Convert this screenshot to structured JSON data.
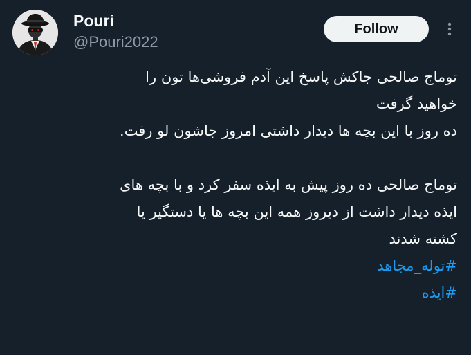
{
  "author": {
    "display_name": "Pouri",
    "handle": "@Pouri2022",
    "avatar_icon": "masked-man-avatar"
  },
  "actions": {
    "follow_label": "Follow",
    "more_icon": "more-vertical-icon"
  },
  "tweet": {
    "lines": [
      "توماج صالحی جاکش پاسخ این آدم فروشی‌ها تون را",
      "خواهید گرفت",
      "ده روز با این بچه ها دیدار داشتی امروز جاشون لو رفت.",
      "",
      "توماج صالحی ده روز پیش به ایذه سفر کرد و با بچه های",
      "ایذه دیدار داشت از دیروز همه این بچه ها یا دستگیر یا",
      "کشته شدند"
    ],
    "hashtags": [
      "#توله_مجاهد",
      "#ایذه"
    ]
  },
  "colors": {
    "background": "#15202b",
    "text": "#f7f9f9",
    "secondary_text": "#8b98a5",
    "link": "#1d9bf0",
    "button_bg": "#eff3f4"
  }
}
